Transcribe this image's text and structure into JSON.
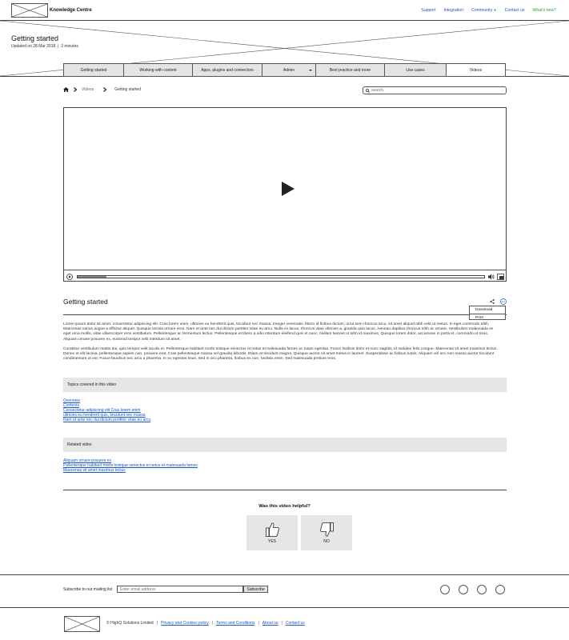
{
  "header": {
    "brand": "Knowledge Centre",
    "nav": [
      {
        "label": "Support"
      },
      {
        "label": "Integration"
      },
      {
        "label": "Community"
      },
      {
        "label": "Contact us"
      },
      {
        "label": "What's new?"
      }
    ],
    "accent_link_color": "#1a56c4",
    "new_link_color": "#2aa52a"
  },
  "hero": {
    "title": "Getting started",
    "updated": "Updated on 28 Mar 2018",
    "read_time": "2 minutes"
  },
  "tabs": [
    {
      "label": "Getting started"
    },
    {
      "label": "Working with content"
    },
    {
      "label": "Apps, plugins and connectors"
    },
    {
      "label": "Admin"
    },
    {
      "label": "Best practice and more"
    },
    {
      "label": "Use cases"
    },
    {
      "label": "Videos"
    }
  ],
  "breadcrumb": {
    "items": [
      "Videos",
      "Getting started"
    ]
  },
  "search": {
    "placeholder": "search"
  },
  "video": {
    "progress": 0.07
  },
  "article": {
    "title": "Getting started",
    "menu": [
      "Download",
      "Print"
    ],
    "paragraphs": [
      "Lorem ipsum dolor sit amet, consectetur adipiscing elit. Cras lorem enim, ultricies eu hendrerit quis, tincidunt nec massa. Integer venenatis, libero id finibus dictum, urna sem rhoncus arcu, sit amet aliquet nibh velit ut metus. In eget commodo nibh. Maecenas varius augue a efficitur aliquet. Quisque lacinia ornare eros. Nam et ante nec dui dictum porttitor vitae eu arcu. Nulla ex lacus, rhoncus vitae ultricies a, gravida quis lacus. Aenean dapibus rhoncus nibh ac ornare. Vestibulum malesuada ex eget urna mollis, vitae ullamcorper eros vestibulum. Pellentesque ac fermentum lectus. Pellentesque et libero a odio interdum eleifend quis et nunc. Nullam laoreet ut nibh id maximus. Quisque lorem dolor, accumsan in porta et, commodo ut risus. Aliquam ornare posuere ex, euismod tempor velit interdum sit amet.",
      "Curabitur vestibulum mattis dui, quis tempor velit iaculis et. Pellentesque habitant morbi tristique senectus et netus et malesuada fames ac turpis egestas. Fusce facilisis dolor et nunc sagittis, id sodales felis congue. Maecenas sit amet maximus lectus. Donec et elit lacinia, pellentesque sapien non, posuere erat. Cras pellentesque massa vel gravida lobortis. Etiam at tincidunt magna. Quisque auctor sit amet metus in laoreet. Suspendisse ac finibus turpis. Aliquam vel orci non massa auctor tincidunt condimentum ut est. Fusce faucibus nec arcu a pharetra. In eu egestas risus. Sed in orci pharetra, finibus ex non, facilisis enim. Sed malesuada pretium eros."
    ]
  },
  "topics": {
    "heading": "Topics covered in this video",
    "links": [
      "Overview",
      "Contents",
      "Consectetur adipiscing elit Cras lorem enim",
      "ultricies eu hendrerit quis, tincidunt nec massa",
      "Nam et ante nec dui dictum porttitor vitae eu arcu"
    ]
  },
  "related": {
    "heading": "Related video",
    "links": [
      "Aliquam ornare posuere ex",
      "Pellentesque habitant morbi tristique senectus et netus et malesuada fames",
      "Maecenas sit amet maximus lectus"
    ]
  },
  "feedback": {
    "question": "Was this video helpful?",
    "yes": "YES",
    "no": "NO"
  },
  "footer": {
    "subscribe_label": "Subscribe to our mailing list",
    "email_placeholder": "Enter email address",
    "subscribe_button": "Subscribe",
    "copyright": "© HighQ Solutions Limited",
    "legal_links": [
      "Privacy and Cookies policy",
      "Terms and Conditions",
      "About us",
      "Contact us"
    ]
  }
}
